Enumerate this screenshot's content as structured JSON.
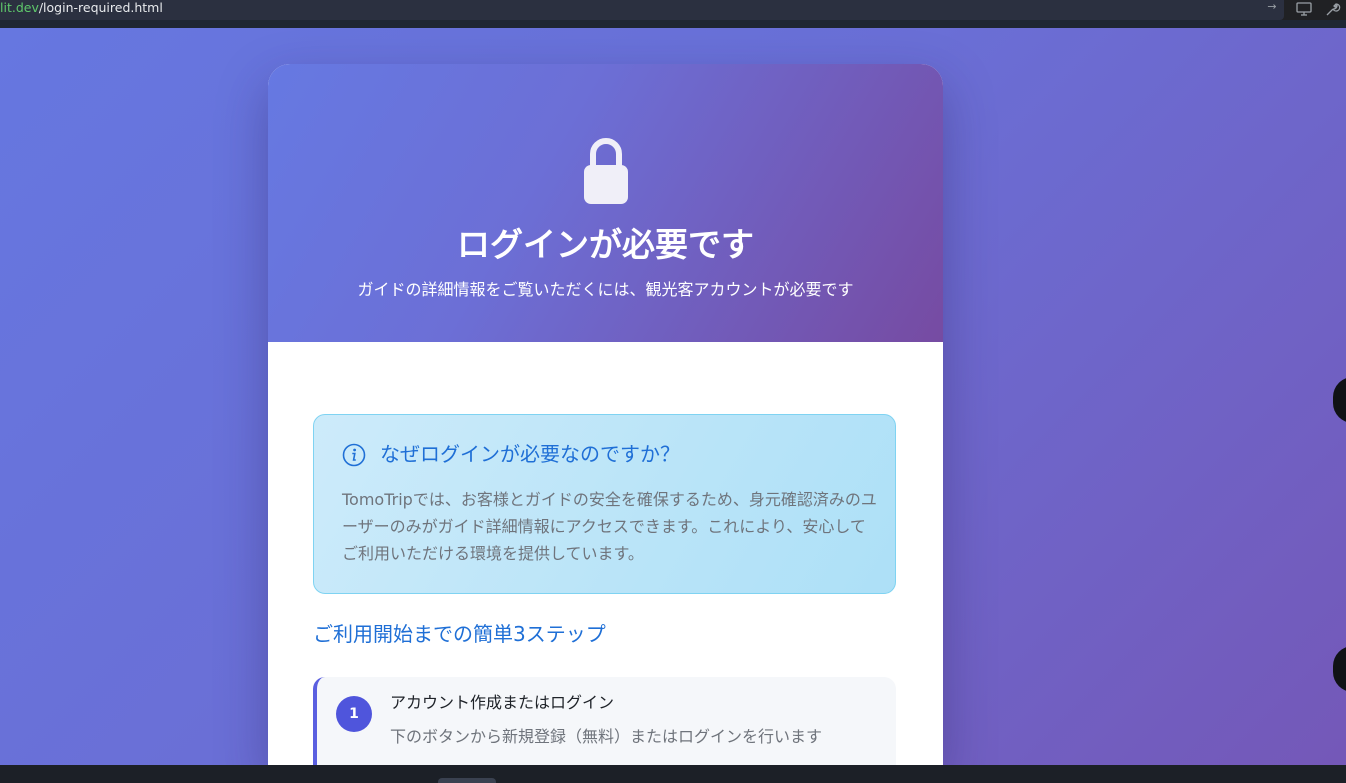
{
  "browser": {
    "url_host": "lit.dev",
    "url_path": "/login-required.html"
  },
  "hero": {
    "icon": "lock-icon",
    "title": "ログインが必要です",
    "subtitle": "ガイドの詳細情報をご覧いただくには、観光客アカウントが必要です"
  },
  "info": {
    "icon": "info-circle-icon",
    "title": "なぜログインが必要なのですか？",
    "body": "TomoTripでは、お客様とガイドの安全を確保するため、身元確認済みのユーザーのみがガイド詳細情報にアクセスできます。これにより、安心してご利用いただける環境を提供しています。"
  },
  "steps": {
    "title": "ご利用開始までの簡単3ステップ",
    "items": [
      {
        "number": "1",
        "title": "アカウント作成またはログイン",
        "description": "下のボタンから新規登録（無料）またはログインを行います"
      }
    ]
  },
  "colors": {
    "accent": "#1f6fd6",
    "step_badge": "#4f55dc",
    "gradient_start": "#667eea",
    "gradient_end": "#764ba2"
  }
}
